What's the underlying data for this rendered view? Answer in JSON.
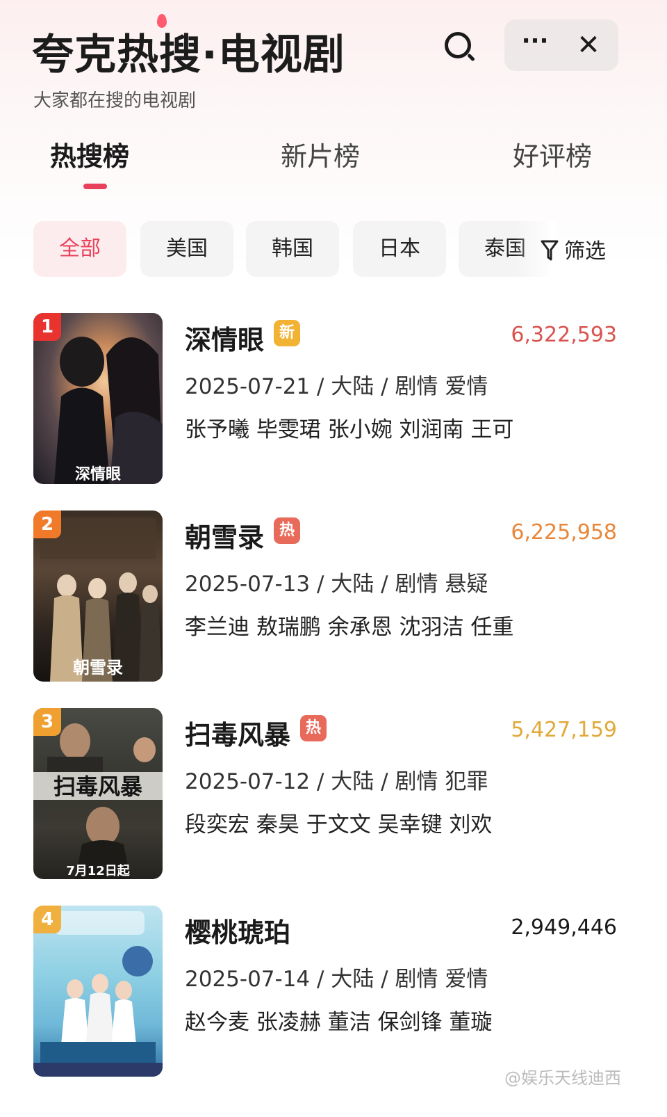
{
  "header": {
    "title": "夸克热搜·电视剧",
    "subtitle": "大家都在搜的电视剧",
    "search_icon": "search-icon",
    "more_label": "···",
    "close_label": "✕"
  },
  "tabs": [
    {
      "label": "热搜榜",
      "active": true
    },
    {
      "label": "新片榜",
      "active": false
    },
    {
      "label": "好评榜",
      "active": false
    }
  ],
  "filters": {
    "chips": [
      "全部",
      "美国",
      "韩国",
      "日本",
      "泰国"
    ],
    "active_chip": "全部",
    "filter_label": "筛选",
    "filter_icon": "funnel-icon"
  },
  "list": [
    {
      "rank": "1",
      "title": "深情眼",
      "badge": "新",
      "badge_color": "#f2b233",
      "heat": "6,322,593",
      "heat_color": "#d9534f",
      "meta": "2025-07-21 / 大陆 / 剧情 爱情",
      "cast": "张予曦 毕雯珺 张小婉 刘润南 王可",
      "rank_color": "#e8332f",
      "poster_text": "深情眼"
    },
    {
      "rank": "2",
      "title": "朝雪录",
      "badge": "热",
      "badge_color": "#e86a5a",
      "heat": "6,225,958",
      "heat_color": "#e8873a",
      "meta": "2025-07-13 / 大陆 / 剧情 悬疑",
      "cast": "李兰迪 敖瑞鹏 余承恩 沈羽洁 任重",
      "rank_color": "#f07a2a",
      "poster_text": "朝雪录"
    },
    {
      "rank": "3",
      "title": "扫毒风暴",
      "badge": "热",
      "badge_color": "#e86a5a",
      "heat": "5,427,159",
      "heat_color": "#e0a93a",
      "meta": "2025-07-12 / 大陆 / 剧情 犯罪",
      "cast": "段奕宏 秦昊 于文文 吴幸键 刘欢",
      "rank_color": "#f0a030",
      "poster_text": "7月12日起"
    },
    {
      "rank": "4",
      "title": "樱桃琥珀",
      "badge": "",
      "badge_color": "",
      "heat": "2,949,446",
      "heat_color": "#1a1a1a",
      "meta": "2025-07-14 / 大陆 / 剧情 爱情",
      "cast": "赵今麦 张凌赫 董洁 保剑锋 董璇",
      "rank_color": "#f0b040",
      "poster_text": ""
    }
  ],
  "watermark": "@娱乐天线迪西"
}
